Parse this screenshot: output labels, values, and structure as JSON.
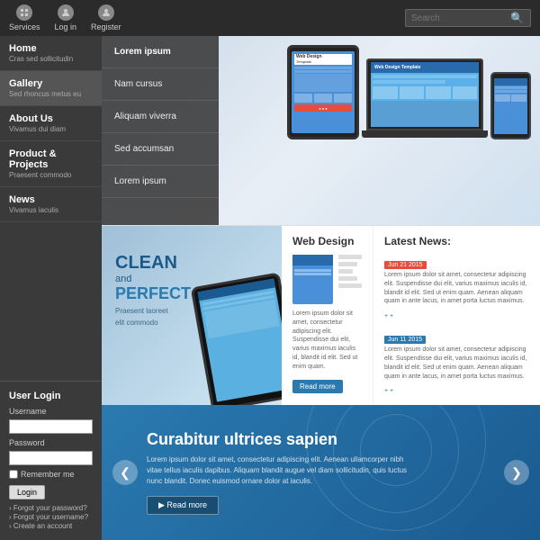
{
  "topnav": {
    "items": [
      {
        "label": "Services",
        "icon": "services-icon"
      },
      {
        "label": "Log in",
        "icon": "login-icon"
      },
      {
        "label": "Register",
        "icon": "register-icon"
      }
    ],
    "search_placeholder": "Search"
  },
  "sidebar": {
    "items": [
      {
        "title": "Home",
        "sub": "Cras sed sollicitudin",
        "active": false
      },
      {
        "title": "Gallery",
        "sub": "Sed rhoncus metus eu",
        "active": true
      },
      {
        "title": "About Us",
        "sub": "Vivamus dui diam",
        "active": false
      },
      {
        "title": "Product & Projects",
        "sub": "Praesent commodo",
        "active": false
      },
      {
        "title": "News",
        "sub": "Vivamus iaculis",
        "active": false
      }
    ]
  },
  "dropdown": {
    "items": [
      {
        "label": "Lorem ipsum",
        "highlighted": true
      },
      {
        "label": "Nam cursus"
      },
      {
        "label": "Aliquam viverra"
      },
      {
        "label": "Sed accumsan"
      },
      {
        "label": "Lorem ipsum"
      }
    ]
  },
  "hero": {
    "devices": [
      "tablet",
      "laptop",
      "phone"
    ]
  },
  "tablet_hand": {
    "clean": "CLEAN",
    "and": "and",
    "perfect": "PERFECT",
    "sub_line1": "Praesent laoreet",
    "sub_line2": "elit commodo"
  },
  "web_design": {
    "title": "Web Design",
    "description": "Lorem ipsum dolor sit amet, consectetur adipiscing elit. Suspendisse dui elit, varius maximus iaculis id, blandit id elit. Sed ut enim quam.",
    "read_more": "Read more"
  },
  "latest_news": {
    "title": "Latest News:",
    "items": [
      {
        "date": "Jun 21 2015",
        "badge_color": "red",
        "text": "Lorem ipsum dolor sit amet, consectetur adipiscing elit. Suspendisse dui elit, varius maximus iaculis id, blandit id elit. Sed ut enim quam. Aenean aliquam quam in ante lacus, in amet porta luctus maximus.",
        "more": "+ +"
      },
      {
        "date": "Jun 11 2015",
        "badge_color": "blue",
        "text": "Lorem ipsum dolor sit amet, consectetur adipiscing elit. Suspendisse dui elit, varius maximus iaculis id, blandit id elit. Sed ut enim quam. Aenean aliquam quam in ante lacus, in amet porta luctus maximus.",
        "more": "+ +"
      }
    ]
  },
  "banner": {
    "title": "Curabitur ultrices sapien",
    "text": "Lorem ipsum dolor sit amet, consectetur adipiscing elit. Aenean ullamcorper nibh vitae tellus iaculis dapibus. Aliquam blandit augue vel diam sollicitudin, quis luctus nunc blandit. Donec euismod ornare dolor at iaculis.",
    "read_more": "▶  Read more",
    "arrow_left": "❮",
    "arrow_right": "❯"
  },
  "user_login": {
    "title": "User Login",
    "username_label": "Username",
    "password_label": "Password",
    "remember_label": "Remember me",
    "login_btn": "Login",
    "links": [
      "Forgot your password?",
      "Forgot your username?",
      "Create an account"
    ]
  }
}
